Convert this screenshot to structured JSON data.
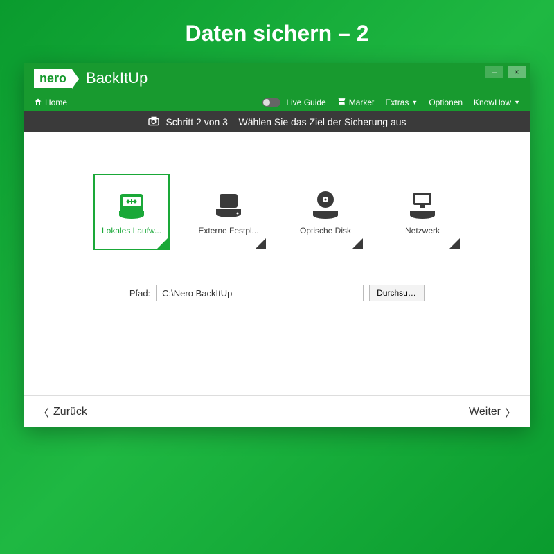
{
  "page_heading": "Daten sichern – 2",
  "app": {
    "brand": "nero",
    "name": "BackItUp"
  },
  "win": {
    "minimize": "–",
    "close": "×"
  },
  "menu": {
    "home": "Home",
    "live_guide": "Live Guide",
    "market": "Market",
    "extras": "Extras",
    "options": "Optionen",
    "knowhow": "KnowHow"
  },
  "stepbar": "Schritt 2 von 3 – Wählen Sie das Ziel der Sicherung aus",
  "targets": [
    {
      "key": "local",
      "label": "Lokales Laufw...",
      "selected": true
    },
    {
      "key": "external",
      "label": "Externe Festpl...",
      "selected": false
    },
    {
      "key": "optical",
      "label": "Optische Disk",
      "selected": false
    },
    {
      "key": "network",
      "label": "Netzwerk",
      "selected": false
    }
  ],
  "path": {
    "label": "Pfad:",
    "value": "C:\\Nero BackItUp",
    "browse": "Durchsuc..."
  },
  "footer": {
    "back": "Zurück",
    "next": "Weiter"
  }
}
